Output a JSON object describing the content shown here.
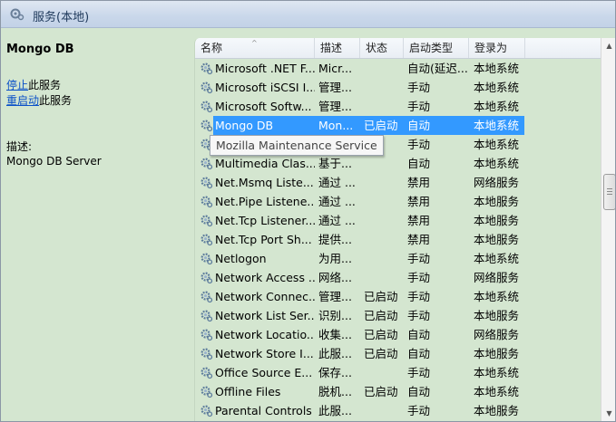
{
  "window": {
    "title": "服务(本地)"
  },
  "left": {
    "service_name": "Mongo DB",
    "stop_link": "停止",
    "stop_suffix": "此服务",
    "restart_link": "重启动",
    "restart_suffix": "此服务",
    "description_label": "描述:",
    "description_text": "Mongo DB Server"
  },
  "columns": {
    "name": "名称",
    "desc": "描述",
    "status": "状态",
    "startup": "启动类型",
    "logon": "登录为"
  },
  "rows": [
    {
      "name": "Microsoft .NET F...",
      "desc": "Micr...",
      "status": "",
      "startup": "自动(延迟...",
      "logon": "本地系统"
    },
    {
      "name": "Microsoft iSCSI I...",
      "desc": "管理...",
      "status": "",
      "startup": "手动",
      "logon": "本地系统"
    },
    {
      "name": "Microsoft Softw...",
      "desc": "管理...",
      "status": "",
      "startup": "手动",
      "logon": "本地系统"
    },
    {
      "name": "Mongo DB",
      "desc": "Mon...",
      "status": "已启动",
      "startup": "自动",
      "logon": "本地系统",
      "selected": true
    },
    {
      "name": "Mozilla Maintenance Service",
      "desc": "",
      "status": "",
      "startup": "手动",
      "logon": "本地系统"
    },
    {
      "name": "Multimedia Clas...",
      "desc": "基于...",
      "status": "",
      "startup": "自动",
      "logon": "本地系统"
    },
    {
      "name": "Net.Msmq Liste...",
      "desc": "通过 ...",
      "status": "",
      "startup": "禁用",
      "logon": "网络服务"
    },
    {
      "name": "Net.Pipe Listene...",
      "desc": "通过 ...",
      "status": "",
      "startup": "禁用",
      "logon": "本地服务"
    },
    {
      "name": "Net.Tcp Listener...",
      "desc": "通过 ...",
      "status": "",
      "startup": "禁用",
      "logon": "本地服务"
    },
    {
      "name": "Net.Tcp Port Sh...",
      "desc": "提供...",
      "status": "",
      "startup": "禁用",
      "logon": "本地服务"
    },
    {
      "name": "Netlogon",
      "desc": "为用...",
      "status": "",
      "startup": "手动",
      "logon": "本地系统"
    },
    {
      "name": "Network Access ...",
      "desc": "网络...",
      "status": "",
      "startup": "手动",
      "logon": "网络服务"
    },
    {
      "name": "Network Connec...",
      "desc": "管理...",
      "status": "已启动",
      "startup": "手动",
      "logon": "本地系统"
    },
    {
      "name": "Network List Ser...",
      "desc": "识别...",
      "status": "已启动",
      "startup": "手动",
      "logon": "本地服务"
    },
    {
      "name": "Network Locatio...",
      "desc": "收集...",
      "status": "已启动",
      "startup": "自动",
      "logon": "网络服务"
    },
    {
      "name": "Network Store I...",
      "desc": "此服...",
      "status": "已启动",
      "startup": "自动",
      "logon": "本地服务"
    },
    {
      "name": "Office  Source E...",
      "desc": "保存...",
      "status": "",
      "startup": "手动",
      "logon": "本地系统"
    },
    {
      "name": "Offline Files",
      "desc": "脱机...",
      "status": "已启动",
      "startup": "自动",
      "logon": "本地系统"
    },
    {
      "name": "Parental Controls",
      "desc": "此服...",
      "status": "",
      "startup": "手动",
      "logon": "本地服务"
    }
  ],
  "tooltip": {
    "text": "Mozilla Maintenance Service"
  },
  "colors": {
    "selection": "#3399ff",
    "pane_bg": "#d4e6d0",
    "link": "#0a50c8"
  },
  "icons": {
    "title": "services-gear-icon",
    "row": "service-gear-icon"
  }
}
